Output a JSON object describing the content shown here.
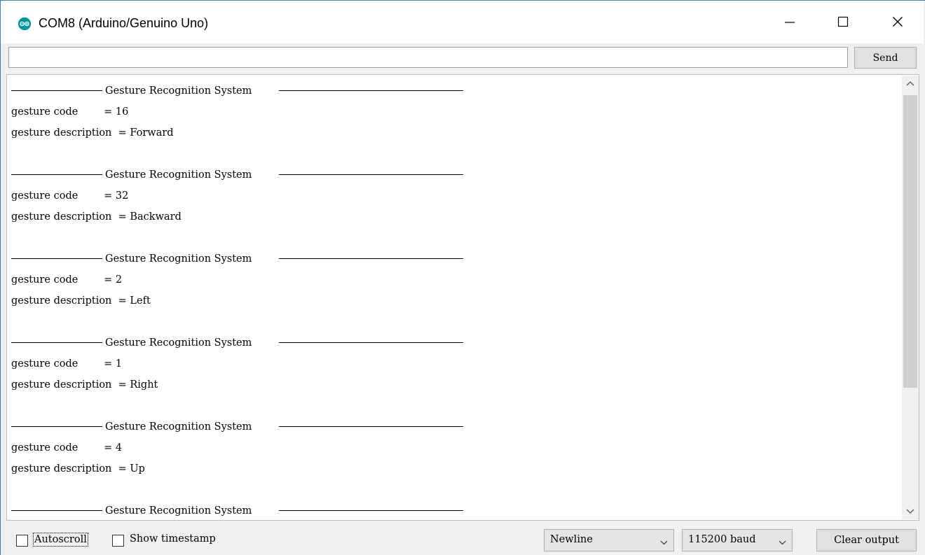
{
  "window": {
    "title": "COM8 (Arduino/Genuino Uno)"
  },
  "send_row": {
    "input_value": "",
    "send_label": "Send"
  },
  "output": {
    "header_text": "Gesture Recognition System",
    "blocks": [
      {
        "code_line": "gesture code        = 16",
        "desc_line": "gesture description  = Forward"
      },
      {
        "code_line": "gesture code        = 32",
        "desc_line": "gesture description  = Backward"
      },
      {
        "code_line": "gesture code        = 2",
        "desc_line": "gesture description  = Left"
      },
      {
        "code_line": "gesture code        = 1",
        "desc_line": "gesture description  = Right"
      },
      {
        "code_line": "gesture code        = 4",
        "desc_line": "gesture description  = Up"
      }
    ]
  },
  "bottom_bar": {
    "autoscroll_label": "Autoscroll",
    "autoscroll_checked": false,
    "timestamp_label": "Show timestamp",
    "timestamp_checked": false,
    "line_ending": "Newline",
    "baud_rate": "115200 baud",
    "clear_label": "Clear output"
  },
  "colors": {
    "arduino_teal": "#00979c",
    "window_border": "#3a7bc4"
  }
}
